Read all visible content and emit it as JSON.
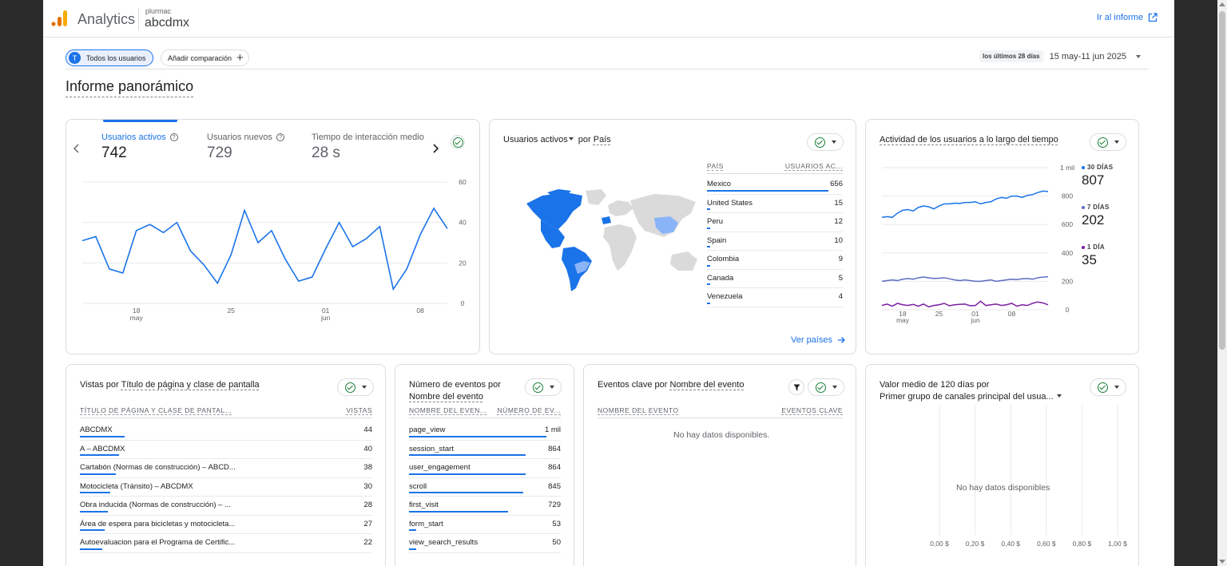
{
  "header": {
    "app_title": "Analytics",
    "account": "plurmac",
    "property": "abcdmx",
    "report_link": "Ir al informe"
  },
  "filters": {
    "segment_avatar": "T",
    "segment": "Todos los usuarios",
    "add_comparison": "Añadir comparación",
    "date_badge": "los últimos 28 días",
    "date_range": "15 may-11 jun 2025"
  },
  "page_title": "Informe panorámico",
  "colors": {
    "accent": "#1a73e8",
    "accent_light": "#8ab4f8",
    "purple": "#7b1fa2",
    "indigo": "#5c6bc0",
    "green": "#188038"
  },
  "card_metrics": {
    "metrics": [
      {
        "label": "Usuarios activos",
        "value": "742"
      },
      {
        "label": "Usuarios nuevos",
        "value": "729"
      },
      {
        "label": "Tiempo de interacción medio",
        "value": "28 s"
      }
    ],
    "chart_data": {
      "type": "line",
      "series": [
        {
          "values": [
            31,
            33,
            17,
            15,
            36,
            39,
            35,
            40,
            26,
            19,
            10,
            24,
            46,
            30,
            36,
            22,
            11,
            13,
            27,
            40,
            28,
            32,
            38,
            7,
            17,
            34,
            47,
            37
          ]
        }
      ],
      "ylim": [
        0,
        60
      ],
      "yticks": [
        "0",
        "20",
        "40",
        "60"
      ],
      "xticks": [
        {
          "day": "18",
          "month": "may"
        },
        {
          "day": "25",
          "month": ""
        },
        {
          "day": "01",
          "month": "jun"
        },
        {
          "day": "08",
          "month": ""
        }
      ]
    }
  },
  "card_country": {
    "metric": "Usuarios activos",
    "by": "por",
    "dimension": "País",
    "columns": [
      "PAÍS",
      "USUARIOS AC..."
    ],
    "rows": [
      {
        "name": "Mexico",
        "value": "656",
        "frac": 1.0
      },
      {
        "name": "United States",
        "value": "15",
        "frac": 0.023
      },
      {
        "name": "Peru",
        "value": "12",
        "frac": 0.018
      },
      {
        "name": "Spain",
        "value": "10",
        "frac": 0.015
      },
      {
        "name": "Colombia",
        "value": "9",
        "frac": 0.014
      },
      {
        "name": "Canada",
        "value": "5",
        "frac": 0.008
      },
      {
        "name": "Venezuela",
        "value": "4",
        "frac": 0.006
      }
    ],
    "link": "Ver países"
  },
  "card_activity": {
    "title": "Actividad de los usuarios a lo largo del tiempo",
    "legend": [
      {
        "label": "30 DÍAS",
        "value": "807"
      },
      {
        "label": "7 DÍAS",
        "value": "202"
      },
      {
        "label": "1 DÍA",
        "value": "35"
      }
    ],
    "chart_data": {
      "type": "line",
      "series": [
        {
          "name": "30 DÍAS",
          "values": [
            650,
            655,
            650,
            680,
            700,
            705,
            695,
            720,
            730,
            725,
            710,
            730,
            745,
            745,
            750,
            748,
            755,
            755,
            760,
            745,
            755,
            760,
            780,
            790,
            785,
            800,
            800,
            790,
            805,
            810,
            825,
            835,
            832
          ]
        },
        {
          "name": "7 DÍAS",
          "values": [
            200,
            205,
            210,
            205,
            215,
            220,
            215,
            225,
            230,
            225,
            220,
            222,
            225,
            218,
            210,
            205,
            210,
            205,
            200,
            200,
            205,
            210,
            200,
            205,
            210,
            215,
            212,
            218,
            220,
            215,
            225,
            230,
            232
          ]
        },
        {
          "name": "1 DÍA",
          "values": [
            30,
            40,
            25,
            45,
            35,
            30,
            38,
            25,
            40,
            20,
            30,
            35,
            45,
            28,
            35,
            38,
            40,
            28,
            30,
            60,
            30,
            35,
            40,
            30,
            35,
            45,
            25,
            35,
            30,
            45,
            55,
            48,
            35
          ]
        }
      ],
      "ylim": [
        0,
        1000
      ],
      "yticks": [
        "0",
        "200",
        "400",
        "600",
        "800",
        "1 mil"
      ],
      "xticks": [
        {
          "day": "18",
          "month": "may"
        },
        {
          "day": "25",
          "month": ""
        },
        {
          "day": "01",
          "month": "jun"
        },
        {
          "day": "08",
          "month": ""
        }
      ]
    }
  },
  "card_pages": {
    "title_prefix": "Vistas por",
    "dimension": "Título de página y clase de pantalla",
    "columns": [
      "TÍTULO DE PÁGINA Y CLASE DE PANTAL...",
      "VISTAS"
    ],
    "rows": [
      {
        "name": "ABCDMX",
        "value": "44",
        "frac": 0.16
      },
      {
        "name": "A – ABCDMX",
        "value": "40",
        "frac": 0.14
      },
      {
        "name": "Cartabón (Normas de construcción) – ABCD...",
        "value": "38",
        "frac": 0.13
      },
      {
        "name": "Motocicleta (Tránsito) – ABCDMX",
        "value": "30",
        "frac": 0.11
      },
      {
        "name": "Obra inducida (Normas de construcción) – ...",
        "value": "28",
        "frac": 0.1
      },
      {
        "name": "Área de espera para bicicletas y motocicleta...",
        "value": "27",
        "frac": 0.09
      },
      {
        "name": "Autoevaluacion para el Programa de Certific...",
        "value": "22",
        "frac": 0.08
      }
    ]
  },
  "card_events": {
    "title_prefix": "Número de eventos por",
    "dimension": "Nombre del evento",
    "columns": [
      "NOMBRE DEL EVEN...",
      "NÚMERO DE EV..."
    ],
    "rows": [
      {
        "name": "page_view",
        "value": "1 mil",
        "frac": 1.0
      },
      {
        "name": "session_start",
        "value": "864",
        "frac": 0.85
      },
      {
        "name": "user_engagement",
        "value": "864",
        "frac": 0.85
      },
      {
        "name": "scroll",
        "value": "845",
        "frac": 0.83
      },
      {
        "name": "first_visit",
        "value": "729",
        "frac": 0.72
      },
      {
        "name": "form_start",
        "value": "53",
        "frac": 0.05
      },
      {
        "name": "view_search_results",
        "value": "50",
        "frac": 0.05
      }
    ]
  },
  "card_key_events": {
    "title_prefix": "Eventos clave por",
    "dimension": "Nombre del evento",
    "columns": [
      "NOMBRE DEL EVENTO",
      "EVENTOS CLAVE"
    ],
    "empty": "No hay datos disponibles."
  },
  "card_ltv": {
    "title_line1": "Valor medio de 120 días por",
    "title_line2": "Primer grupo de canales principal del usua...",
    "empty": "No hay datos disponibles",
    "xticks": [
      "0,00 $",
      "0,20 $",
      "0,40 $",
      "0,60 $",
      "0,80 $",
      "1,00 $"
    ]
  }
}
